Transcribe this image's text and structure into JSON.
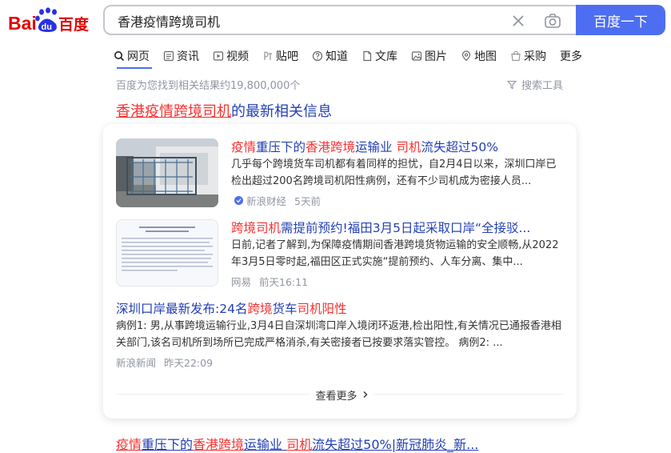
{
  "header": {
    "logo_left": "Bai",
    "logo_paw": "du",
    "logo_right": "百度",
    "query": "香港疫情跨境司机",
    "search_button": "百度一下"
  },
  "tabs": [
    {
      "label": "网页",
      "icon": "search-icon"
    },
    {
      "label": "资讯",
      "icon": "news-icon"
    },
    {
      "label": "视频",
      "icon": "video-icon"
    },
    {
      "label": "贴吧",
      "icon": "tieba-icon"
    },
    {
      "label": "知道",
      "icon": "question-icon"
    },
    {
      "label": "文库",
      "icon": "doc-icon"
    },
    {
      "label": "图片",
      "icon": "image-icon"
    },
    {
      "label": "地图",
      "icon": "map-icon"
    },
    {
      "label": "采购",
      "icon": "shop-icon"
    },
    {
      "label": "更多",
      "icon": ""
    }
  ],
  "results": {
    "count_text": "百度为您找到相关结果约19,800,000个",
    "tools_label": "搜索工具"
  },
  "section": {
    "title_hl": "香港疫情跨境司机",
    "title_rest": "的最新相关信息"
  },
  "news": [
    {
      "title_parts": [
        "疫情",
        "重压下的",
        "香港跨境",
        "运输业 ",
        "司机",
        "流失超过50%"
      ],
      "abstract": "几乎每个跨境货车司机都有着同样的担忧，自2月4日以来，深圳口岸已检出超过200名跨境司机阳性病例，还有不少司机成为密接人员...",
      "source": "新浪财经",
      "time": "5天前"
    },
    {
      "title_parts": [
        "跨境司机",
        "需提前预约!福田3月5日起采取口岸“全接驳..."
      ],
      "abstract": "日前,记者了解到,为保障疫情期间香港跨境货物运输的安全顺畅,从2022年3月5日零时起,福田区正式实施“提前预约、人车分离、集中...",
      "source": "网易",
      "time": "前天16:11"
    },
    {
      "title_parts": [
        "深圳口岸最新发布:24名",
        "跨境",
        "货车",
        "司机阳性"
      ],
      "abstract": "病例1: 男,从事跨境运输行业,3月4日自深圳湾口岸入境闭环返港,检出阳性,有关情况已通报香港相关部门,该名司机所到场所已完成严格消杀,有关密接者已按要求落实管控。 病例2: ...",
      "source": "新浪新闻",
      "time": "昨天22:09"
    }
  ],
  "more_label": "查看更多",
  "bottom_title_parts": [
    "疫情",
    "重压下的",
    "香港跨境",
    "运输业 ",
    "司机",
    "流失超过50%|新冠肺炎_新..."
  ],
  "colors": {
    "accent": "#4e6ef2",
    "link": "#2440b3",
    "highlight": "#f73131",
    "muted": "#9195a3"
  }
}
